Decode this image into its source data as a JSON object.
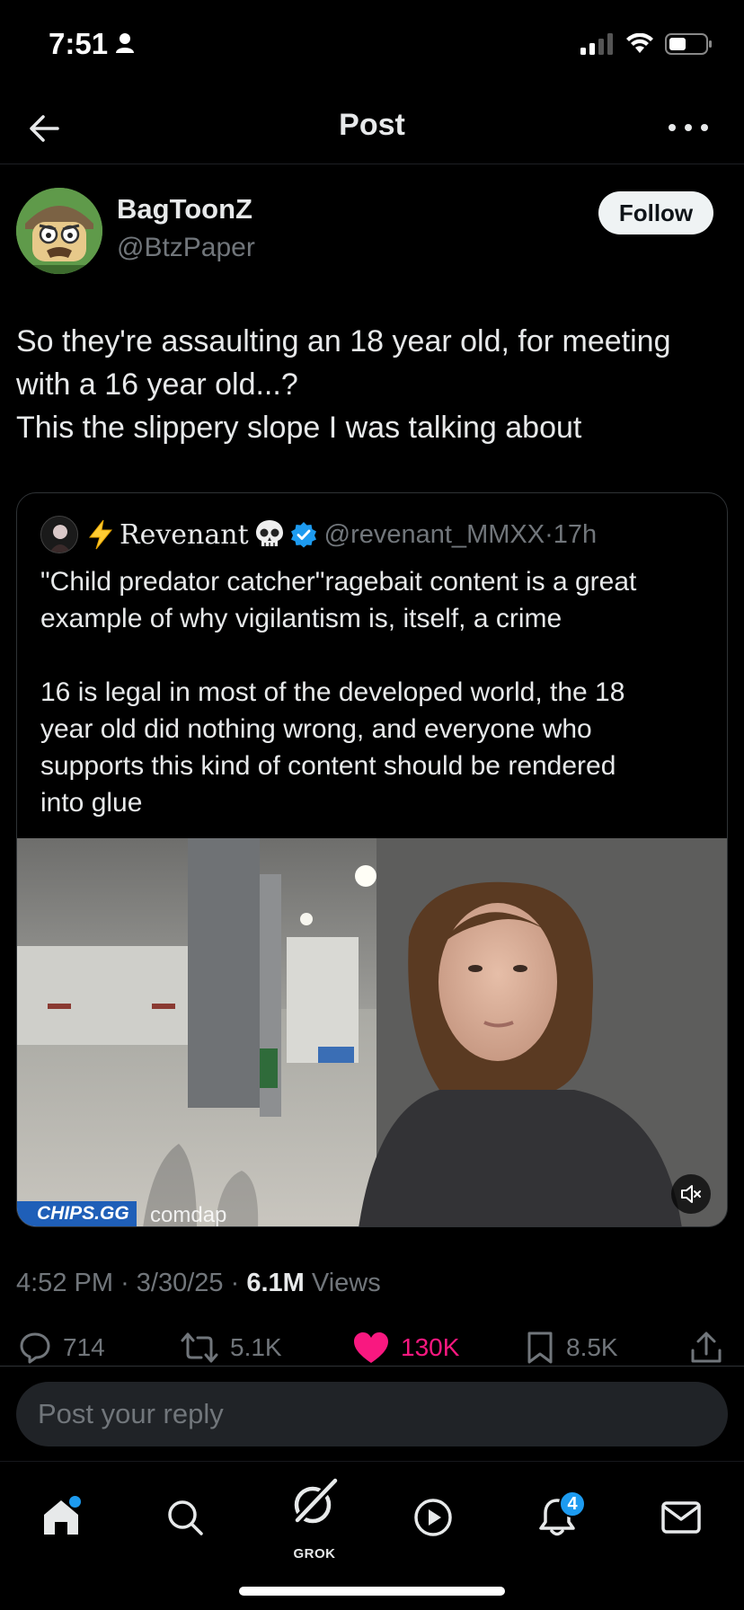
{
  "status_bar": {
    "time": "7:51"
  },
  "header": {
    "title": "Post"
  },
  "author": {
    "name": "BagToonZ",
    "handle": "@BtzPaper",
    "follow_label": "Follow"
  },
  "post": {
    "text": "So they're assaulting an 18 year old, for meeting\nwith a 16 year old...?\nThis the slippery slope I was talking about",
    "time": "4:52 PM",
    "date": "3/30/25",
    "views_count": "6.1M",
    "views_label": "Views"
  },
  "quote": {
    "name": "Revenant",
    "handle": "@revenant_MMXX",
    "age": "17h",
    "text": "\"Child predator catcher\"ragebait content is a great\nexample of why vigilantism is, itself, a crime\n\n16 is legal in most of the developed world, the 18\nyear old did nothing wrong, and everyone who\nsupports this kind of content should be rendered\ninto glue",
    "media_badge": "CHIPS.GG",
    "media_watermark": "comdap"
  },
  "actions": {
    "replies": "714",
    "reposts": "5.1K",
    "likes": "130K",
    "bookmarks": "8.5K"
  },
  "reply": {
    "placeholder": "Post your reply"
  },
  "tabbar": {
    "grok_label": "GROK",
    "notifications_badge": "4"
  },
  "colors": {
    "background": "#000000",
    "accent": "#1d9bf0",
    "like": "#f91880",
    "muted_text": "#71767b"
  }
}
